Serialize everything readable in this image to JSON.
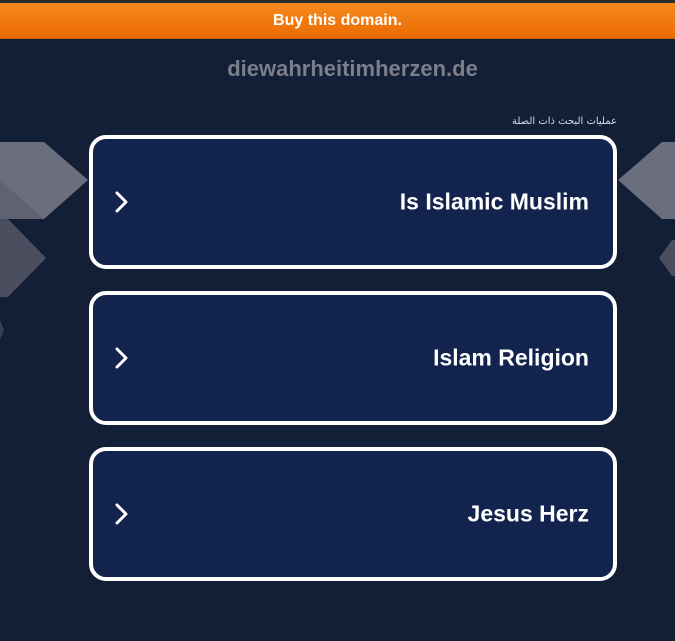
{
  "banner": {
    "label": "Buy this domain."
  },
  "domain": {
    "name": "diewahrheitimherzen.de"
  },
  "related": {
    "heading": "عمليات البحث ذات الصلة",
    "links": [
      {
        "label": "Is Islamic Muslim",
        "icon": "chevron-right-icon"
      },
      {
        "label": "Islam Religion",
        "icon": "chevron-right-icon"
      },
      {
        "label": "Jesus Herz",
        "icon": "chevron-right-icon"
      }
    ]
  },
  "colors": {
    "background": "#131e37",
    "banner": "#f07a10",
    "card": "#12244e",
    "card_border": "#ffffff"
  }
}
